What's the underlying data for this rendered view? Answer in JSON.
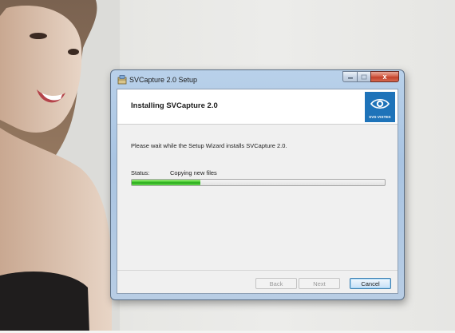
{
  "window": {
    "title": "SVCapture 2.0 Setup",
    "caption_buttons": {
      "minimize_icon": "minimize-icon",
      "maximize_icon": "maximize-icon",
      "close_icon": "close-icon",
      "close_glyph": "x"
    }
  },
  "header": {
    "title": "Installing SVCapture 2.0",
    "logo_text": "SVS-VISTEK"
  },
  "body": {
    "message": "Please wait while the Setup Wizard installs SVCapture 2.0.",
    "status_label": "Status:",
    "status_value": "Copying new files",
    "progress_fraction": 0.27
  },
  "buttons": {
    "back_label": "Back",
    "next_label": "Next",
    "cancel_label": "Cancel"
  },
  "colors": {
    "progress_green": "#3fc42a",
    "logo_blue": "#1e73b9",
    "close_red": "#c2402a"
  }
}
